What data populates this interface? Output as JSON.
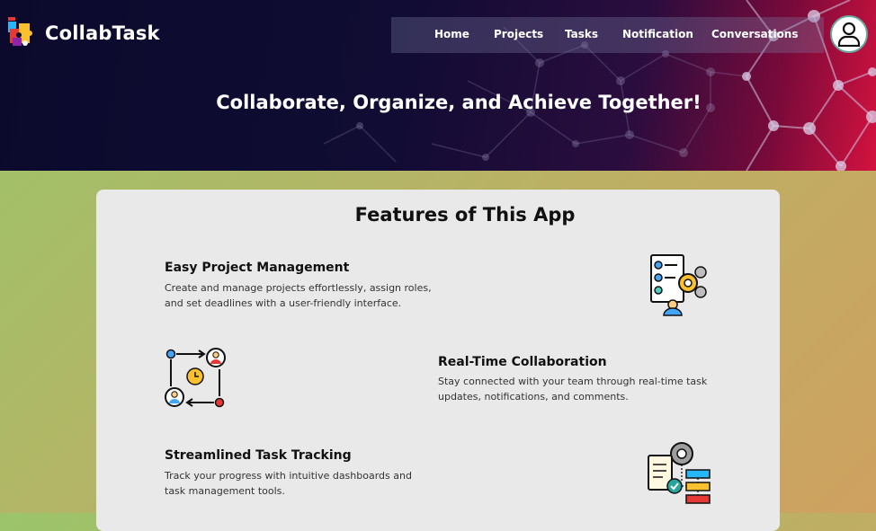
{
  "brand": {
    "name": "CollabTask",
    "logo_icon": "puzzle-logo-icon"
  },
  "nav": {
    "items": [
      {
        "label": "Home"
      },
      {
        "label": "Projects"
      },
      {
        "label": "Tasks"
      },
      {
        "label": "Notification"
      },
      {
        "label": "Conversations"
      }
    ],
    "profile_icon": "user-profile-icon"
  },
  "hero": {
    "headline": "Collaborate, Organize, and Achieve Together!"
  },
  "features": {
    "heading": "Features of This App",
    "items": [
      {
        "title": "Easy Project Management",
        "description": "Create and manage projects effortlessly, assign roles, and set deadlines with a user-friendly interface.",
        "icon": "project-checklist-gear-icon"
      },
      {
        "title": "Real-Time Collaboration",
        "description": "Stay connected with your team through real-time task updates, notifications, and comments.",
        "icon": "team-workflow-icon"
      },
      {
        "title": "Streamlined Task Tracking",
        "description": "Track your progress with intuitive dashboards and task management tools.",
        "icon": "task-flowchart-gear-icon"
      }
    ]
  },
  "colors": {
    "hero_dark": "#0b0a2c",
    "hero_accent": "#d4123f",
    "card_bg": "#e9e9e9",
    "page_green": "#9bc46a",
    "page_orange": "#cfa160"
  }
}
